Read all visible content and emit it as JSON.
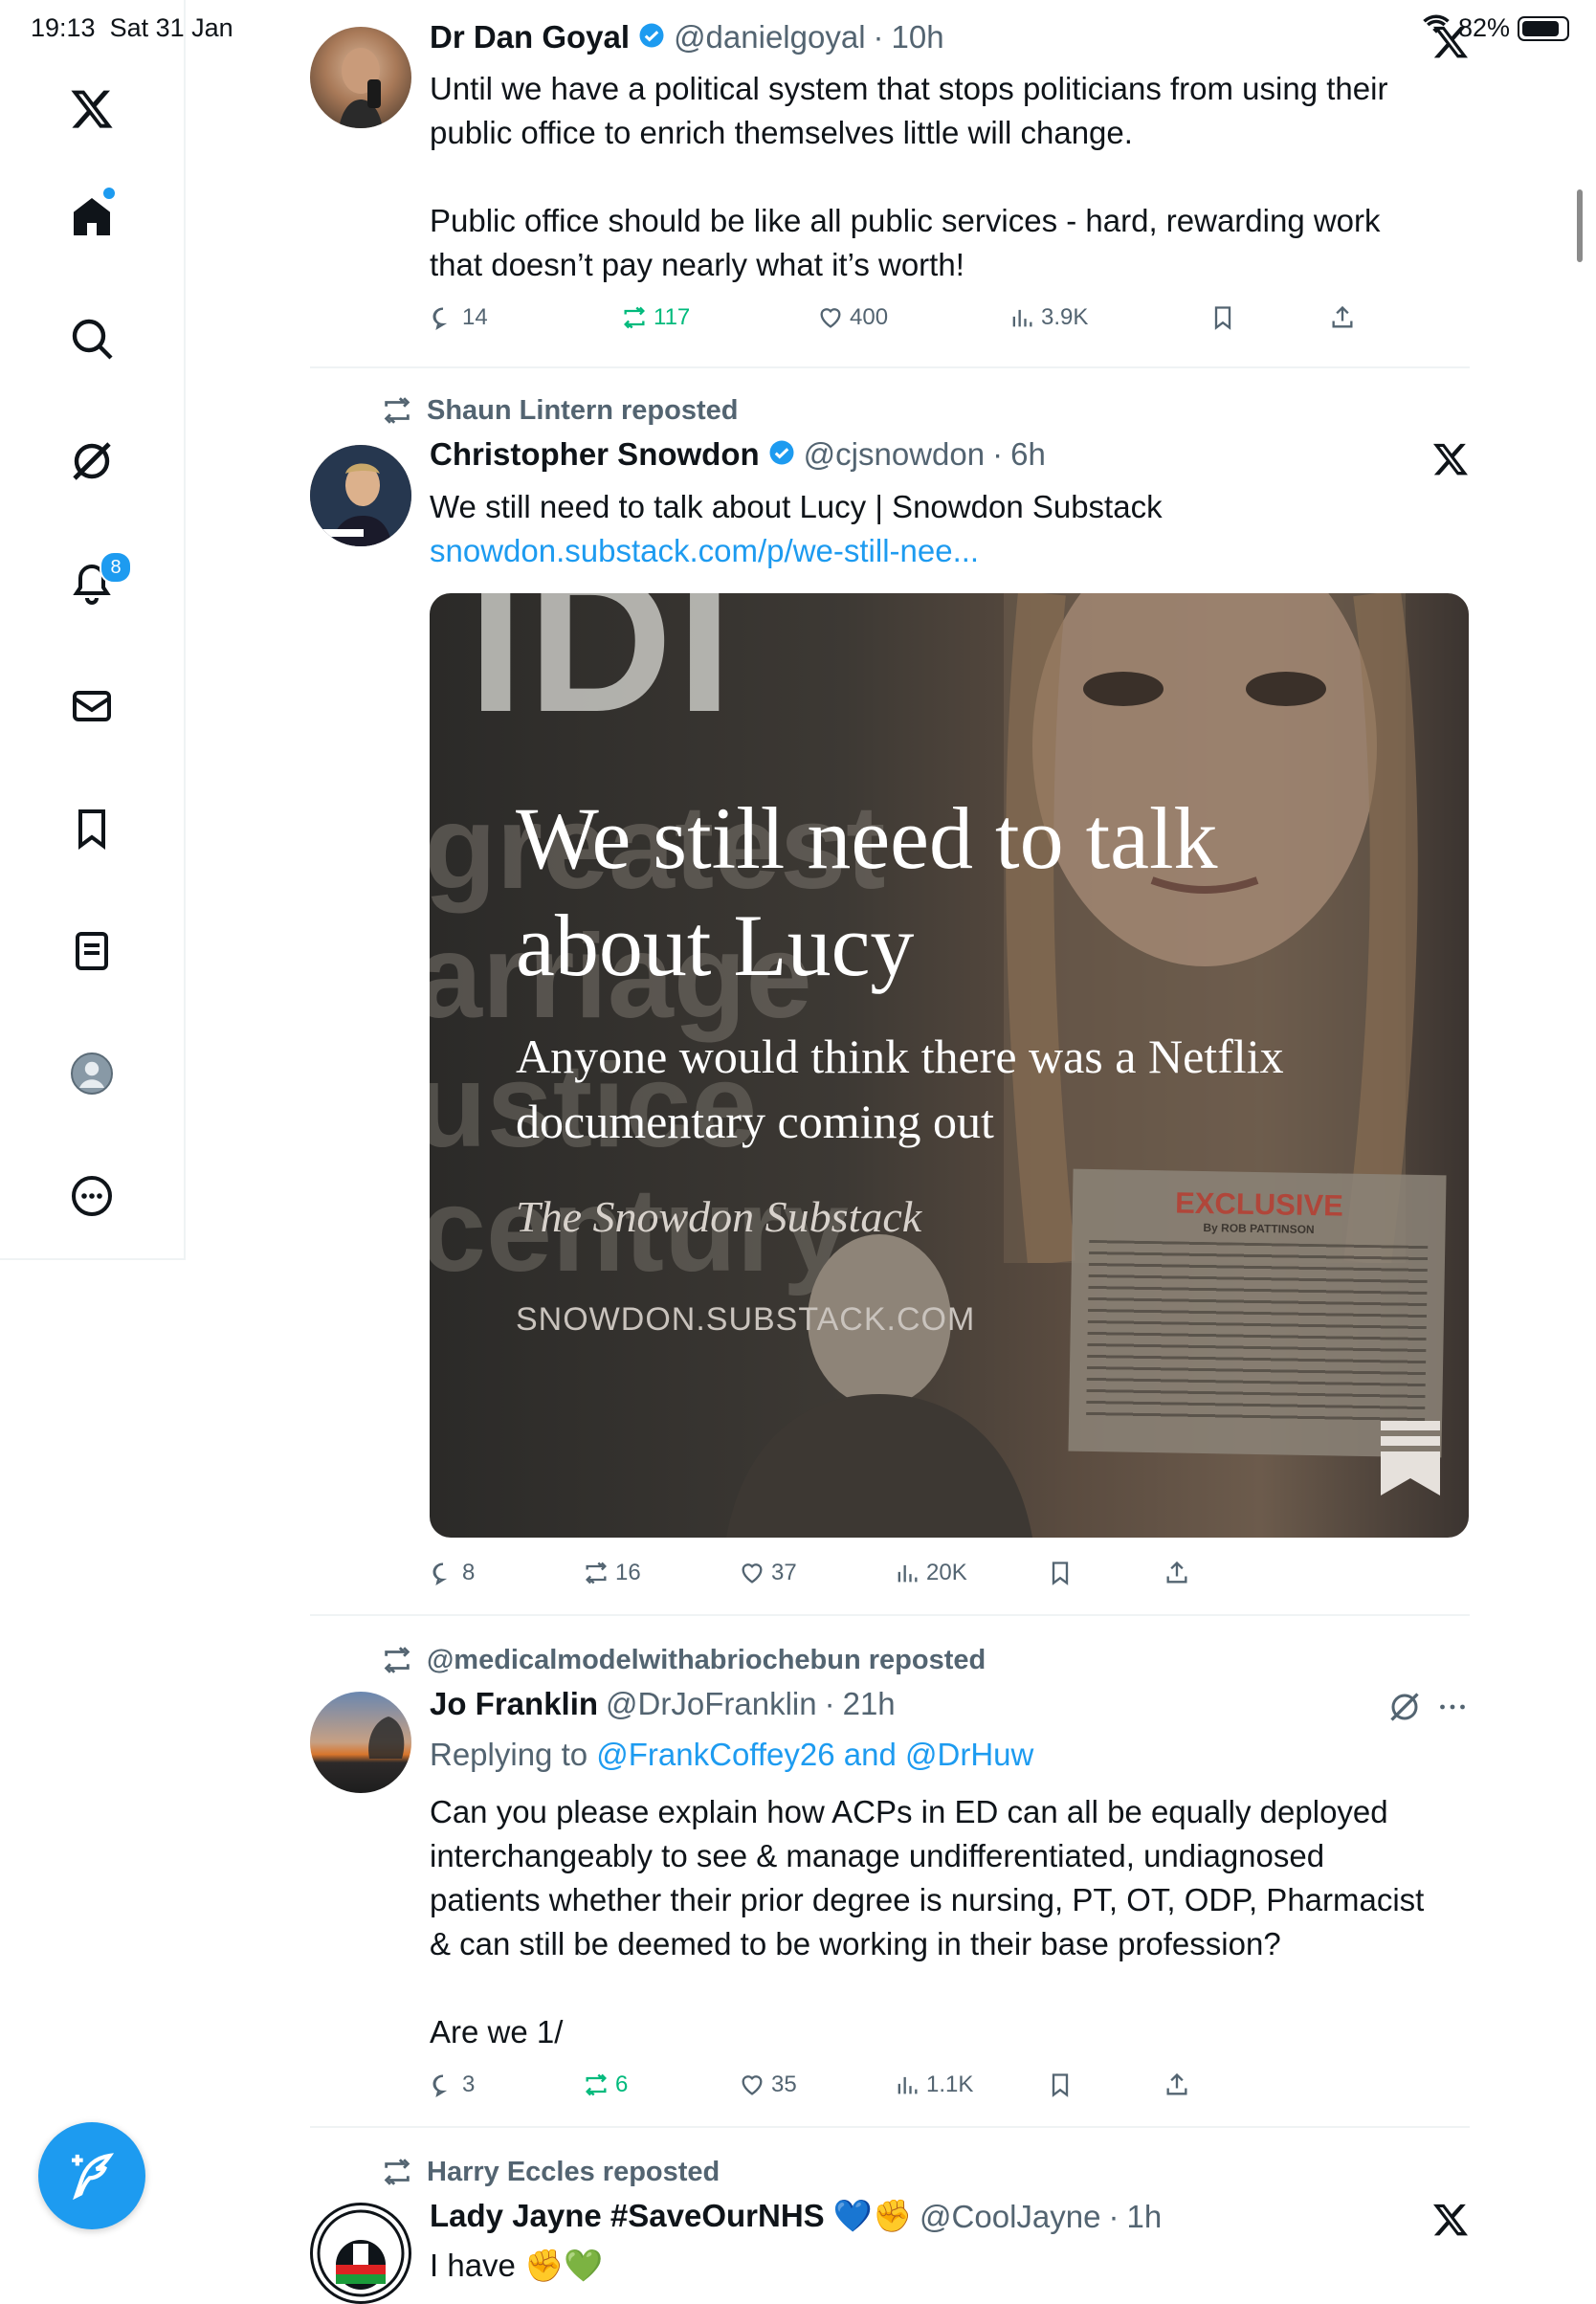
{
  "status_bar": {
    "time": "19:13",
    "date": "Sat 31 Jan",
    "battery": "82%"
  },
  "sidebar": {
    "items": [
      {
        "name": "home"
      },
      {
        "name": "search"
      },
      {
        "name": "grok"
      },
      {
        "name": "notifications",
        "badge": "8"
      },
      {
        "name": "messages"
      },
      {
        "name": "bookmarks"
      },
      {
        "name": "lists"
      },
      {
        "name": "profile"
      },
      {
        "name": "more"
      }
    ]
  },
  "tweets": [
    {
      "name": "Dr Dan Goyal",
      "handle": "@danielgoyal",
      "time": "10h",
      "lines": [
        "Until we have a political system that stops politicians from using their",
        "public office to enrich themselves little will change."
      ],
      "lines2": [
        "Public office should be like all public services - hard, rewarding work",
        "that doesn’t pay nearly what it’s worth!"
      ],
      "stats": {
        "replies": "14",
        "reposts": "117",
        "likes": "400",
        "views": "3.9K"
      }
    },
    {
      "reposted_by": "Shaun Lintern reposted",
      "name": "Christopher Snowdon",
      "handle": "@cjsnowdon",
      "time": "6h",
      "text": "We still need to talk about Lucy | Snowdon Substack",
      "link": "snowdon.substack.com/p/we-still-nee...",
      "card": {
        "title_line1": "We still need to talk",
        "title_line2": "about Lucy",
        "subtitle_line1": "Anyone would think there was a Netflix",
        "subtitle_line2": "documentary coming out",
        "publication": "The Snowdon Substack",
        "domain": "SNOWDON.SUBSTACK.COM",
        "background_words": [
          "IDI",
          "greatest",
          "arriage",
          "ustice",
          "century"
        ],
        "clipping_headline": "EXCLUSIVE",
        "clipping_byline": "By ROB PATTINSON"
      },
      "stats": {
        "replies": "8",
        "reposts": "16",
        "likes": "37",
        "views": "20K"
      }
    },
    {
      "reposted_by": "@medicalmodelwithabriochebun reposted",
      "name": "Jo Franklin",
      "handle": "@DrJoFranklin",
      "time": "21h",
      "replying_prefix": "Replying to ",
      "replying_to": "@FrankCoffey26 and @DrHuw",
      "lines": [
        "Can you please explain how ACPs in ED can all be equally deployed",
        "interchangeably to see & manage undifferentiated, undiagnosed",
        "patients whether their prior degree is nursing, PT, OT, ODP, Pharmacist",
        "& can still be deemed to be working in their base profession?"
      ],
      "tail": "Are we 1/",
      "stats": {
        "replies": "3",
        "reposts": "6",
        "likes": "35",
        "views": "1.1K"
      }
    },
    {
      "reposted_by": "Harry Eccles reposted",
      "name": "Lady Jayne #SaveOurNHS 💙✊",
      "handle": "@CoolJayne",
      "time": "1h",
      "text": "I have ✊💚"
    }
  ],
  "colors": {
    "accent": "#1d9bf0",
    "repost_green": "#00ba7c",
    "secondary_text": "#536471"
  }
}
